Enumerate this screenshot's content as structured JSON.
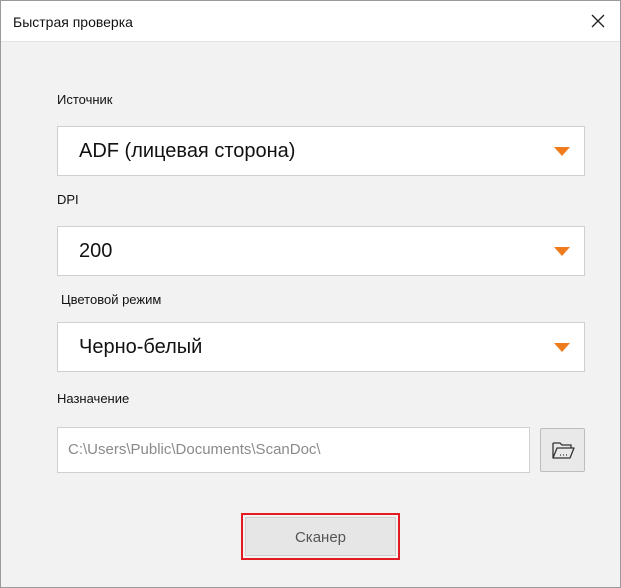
{
  "window": {
    "title": "Быстрая проверка"
  },
  "source": {
    "label": "Источник",
    "value": "ADF (лицевая сторона)"
  },
  "dpi": {
    "label": "DPI",
    "value": "200"
  },
  "color_mode": {
    "label": "Цветовой режим",
    "value": "Черно-белый"
  },
  "destination": {
    "label": "Назначение",
    "path": "C:\\Users\\Public\\Documents\\ScanDoc\\"
  },
  "actions": {
    "scan_label": "Сканер"
  },
  "icons": {
    "close": "close-icon",
    "caret": "caret-down-icon",
    "browse": "folder-open-icon"
  },
  "colors": {
    "accent_caret": "#f07b1c",
    "highlight_border": "#e21b23",
    "content_background": "#f2f2f2"
  }
}
